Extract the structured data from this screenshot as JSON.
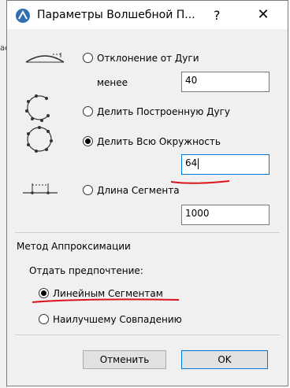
{
  "window": {
    "title": "Параметры Волшебной П...",
    "help": "?",
    "close": "✕"
  },
  "background_fragment": "ас",
  "options": {
    "arc_deviation": {
      "label": "Отклонение от Дуги",
      "less_label": "менее",
      "value": "40",
      "selected": false
    },
    "divide_built_arc": {
      "label": "Делить Построенную Дугу",
      "selected": false
    },
    "divide_circle": {
      "label": "Делить Всю Окружность",
      "value": "64",
      "selected": true
    },
    "segment_length": {
      "label": "Длина Сегмента",
      "value": "1000",
      "selected": false
    }
  },
  "approximation": {
    "title": "Метод Аппроксимации",
    "preference_label": "Отдать предпочтение:",
    "linear_segments": {
      "label": "Линейным Сегментам",
      "selected": true
    },
    "best_fit": {
      "label": "Наилучшему Совпадению",
      "selected": false
    }
  },
  "buttons": {
    "cancel": "Отменить",
    "ok": "OK"
  },
  "colors": {
    "annotation": "#d9141b",
    "focus": "#0078d7",
    "dialog_bg": "#f0f0f0"
  }
}
